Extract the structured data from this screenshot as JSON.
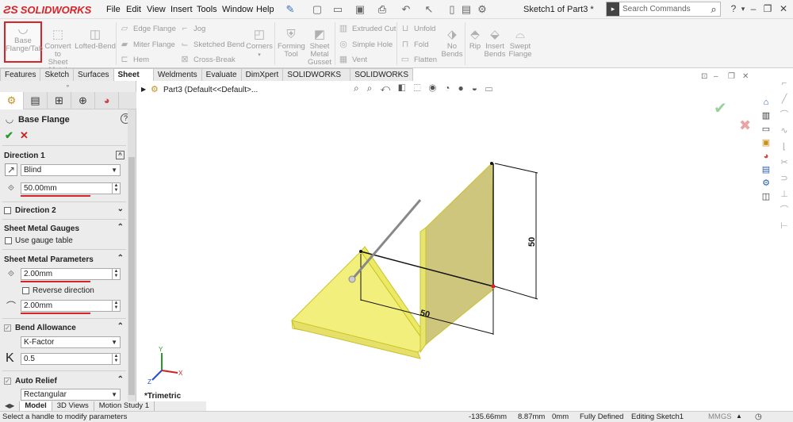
{
  "app": {
    "logo_ds": "ƧS",
    "logo_text": "SOLIDWORKS",
    "doc_title": "Sketch1 of Part3 *"
  },
  "menu": [
    "File",
    "Edit",
    "View",
    "Insert",
    "Tools",
    "Window",
    "Help"
  ],
  "search": {
    "placeholder": "Search Commands"
  },
  "commands": {
    "base_flange": [
      "Base",
      "Flange/Tab"
    ],
    "convert": [
      "Convert",
      "to Sheet",
      "Metal"
    ],
    "lofted_bend": "Lofted-Bend",
    "edge_flange": "Edge Flange",
    "miter_flange": "Miter Flange",
    "hem": "Hem",
    "jog": "Jog",
    "sketched_bend": "Sketched Bend",
    "cross_break": "Cross-Break",
    "corners": "Corners",
    "forming_tool": [
      "Forming",
      "Tool"
    ],
    "sheet_metal_gusset": [
      "Sheet",
      "Metal",
      "Gusset"
    ],
    "extruded_cut": "Extruded Cut",
    "simple_hole": "Simple Hole",
    "vent": "Vent",
    "unfold": "Unfold",
    "fold": "Fold",
    "flatten": "Flatten",
    "no_bends": [
      "No",
      "Bends"
    ],
    "rip": "Rip",
    "insert_bends": [
      "Insert",
      "Bends"
    ],
    "swept_flange": [
      "Swept",
      "Flange"
    ]
  },
  "tabs": [
    "Features",
    "Sketch",
    "Surfaces",
    "Sheet Metal",
    "Weldments",
    "Evaluate",
    "DimXpert",
    "SOLIDWORKS Add-Ins",
    "SOLIDWORKS MBD"
  ],
  "active_tab": "Sheet Metal",
  "tree": {
    "root": "Part3  (Default<<Default>..."
  },
  "pm": {
    "title": "Base Flange",
    "direction1": {
      "header": "Direction 1",
      "end_condition": "Blind",
      "depth": "50.00mm"
    },
    "direction2": {
      "header": "Direction 2",
      "checked": false
    },
    "gauges": {
      "header": "Sheet Metal Gauges",
      "use_gauge_table": "Use gauge table"
    },
    "params": {
      "header": "Sheet Metal Parameters",
      "thickness": "2.00mm",
      "reverse": "Reverse direction",
      "bend_radius": "2.00mm"
    },
    "bend_allowance": {
      "header": "Bend Allowance",
      "type": "K-Factor",
      "label": "K",
      "value": "0.5"
    },
    "auto_relief": {
      "header": "Auto Relief",
      "type": "Rectangular"
    }
  },
  "viewport": {
    "view_label": "*Trimetric",
    "dim_horizontal": "50",
    "dim_vertical": "50",
    "triad": {
      "x": "X",
      "y": "Y",
      "z": "Z"
    }
  },
  "bottom_tabs": [
    "Model",
    "3D Views",
    "Motion Study 1"
  ],
  "status": {
    "message": "Select a handle to modify parameters",
    "x": "-135.66mm",
    "y": "8.87mm",
    "z": "0mm",
    "state": "Fully Defined",
    "editing": "Editing Sketch1",
    "units": "MMGS"
  },
  "colors": {
    "accent": "#d9232a",
    "part_fill": "#f2ef7c",
    "part_edge": "#c9c32a",
    "wall_fill": "#c9c07a"
  }
}
